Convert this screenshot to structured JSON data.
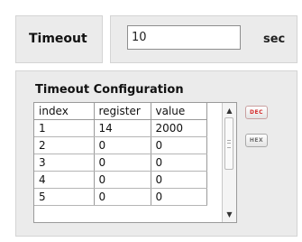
{
  "timeout": {
    "label": "Timeout",
    "value": "10",
    "unit": "sec"
  },
  "config": {
    "title": "Timeout Configuration",
    "columns": [
      "index",
      "register",
      "value"
    ],
    "rows": [
      {
        "index": "1",
        "register": "14",
        "value": "2000"
      },
      {
        "index": "2",
        "register": "0",
        "value": "0"
      },
      {
        "index": "3",
        "register": "0",
        "value": "0"
      },
      {
        "index": "4",
        "register": "0",
        "value": "0"
      },
      {
        "index": "5",
        "register": "0",
        "value": "0"
      }
    ],
    "dec_label": "DEC",
    "hex_label": "HEX"
  },
  "colors": {
    "panel_bg": "#ebebeb",
    "dec_accent": "#d32a2a"
  }
}
